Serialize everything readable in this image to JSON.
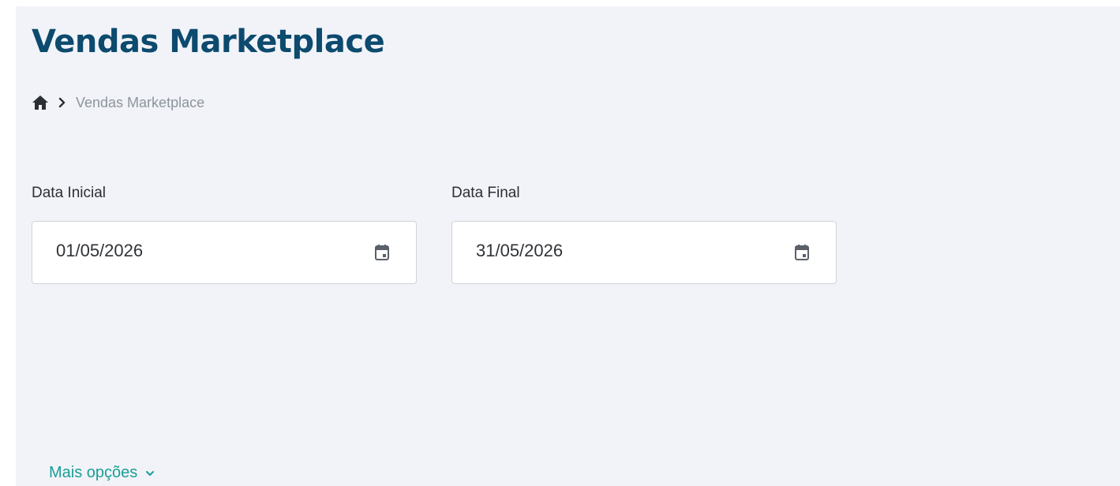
{
  "header": {
    "title": "Vendas Marketplace"
  },
  "breadcrumb": {
    "home_icon": "home-icon",
    "separator_icon": "chevron-right-icon",
    "current": "Vendas Marketplace"
  },
  "filters": {
    "start_date": {
      "label": "Data Inicial",
      "value": "01/05/2026",
      "icon": "calendar-icon"
    },
    "end_date": {
      "label": "Data Final",
      "value": "31/05/2026",
      "icon": "calendar-icon"
    }
  },
  "more_options": {
    "label": "Mais opções",
    "icon": "chevron-down-icon"
  },
  "colors": {
    "title": "#0c4a6e",
    "background": "#f1f3f8",
    "accent": "#1a9e96",
    "breadcrumb_text": "#8d949d"
  }
}
